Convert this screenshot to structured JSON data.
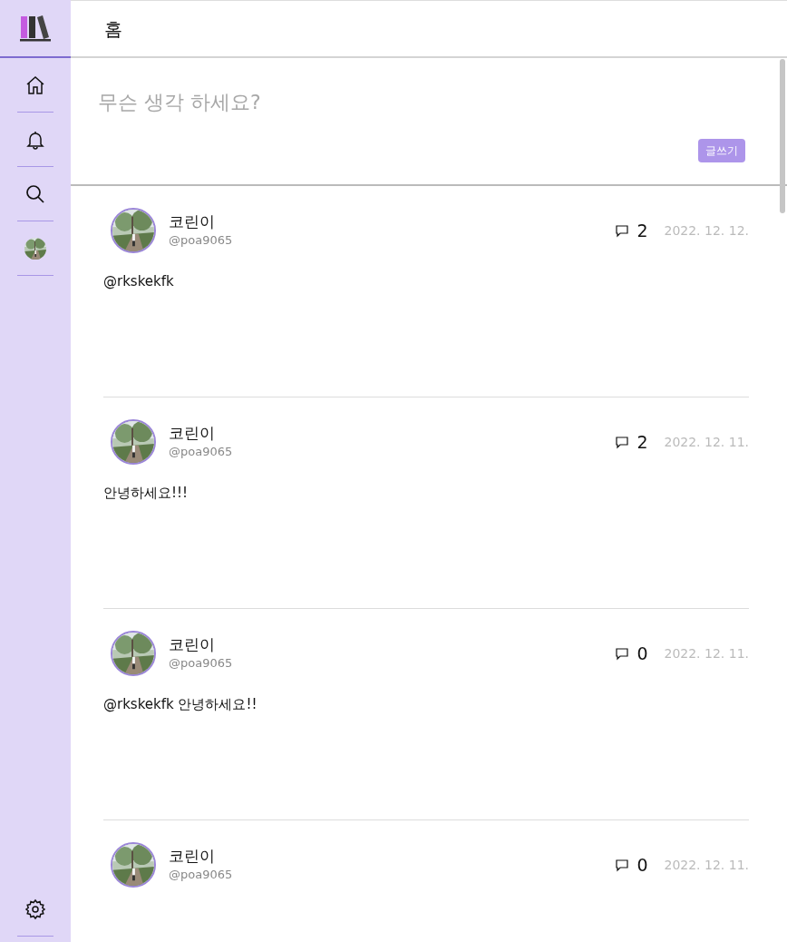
{
  "header": {
    "title": "홈"
  },
  "composer": {
    "placeholder": "무슨 생각 하세요?",
    "button": "글쓰기"
  },
  "posts": [
    {
      "name": "코린이",
      "handle": "@poa9065",
      "comments": "2",
      "date": "2022. 12. 12.",
      "text": "@rkskekfk"
    },
    {
      "name": "코린이",
      "handle": "@poa9065",
      "comments": "2",
      "date": "2022. 12. 11.",
      "text": "안녕하세요!!!"
    },
    {
      "name": "코린이",
      "handle": "@poa9065",
      "comments": "0",
      "date": "2022. 12. 11.",
      "text": "@rkskekfk 안녕하세요!!"
    },
    {
      "name": "코린이",
      "handle": "@poa9065",
      "comments": "0",
      "date": "2022. 12. 11."
    }
  ]
}
